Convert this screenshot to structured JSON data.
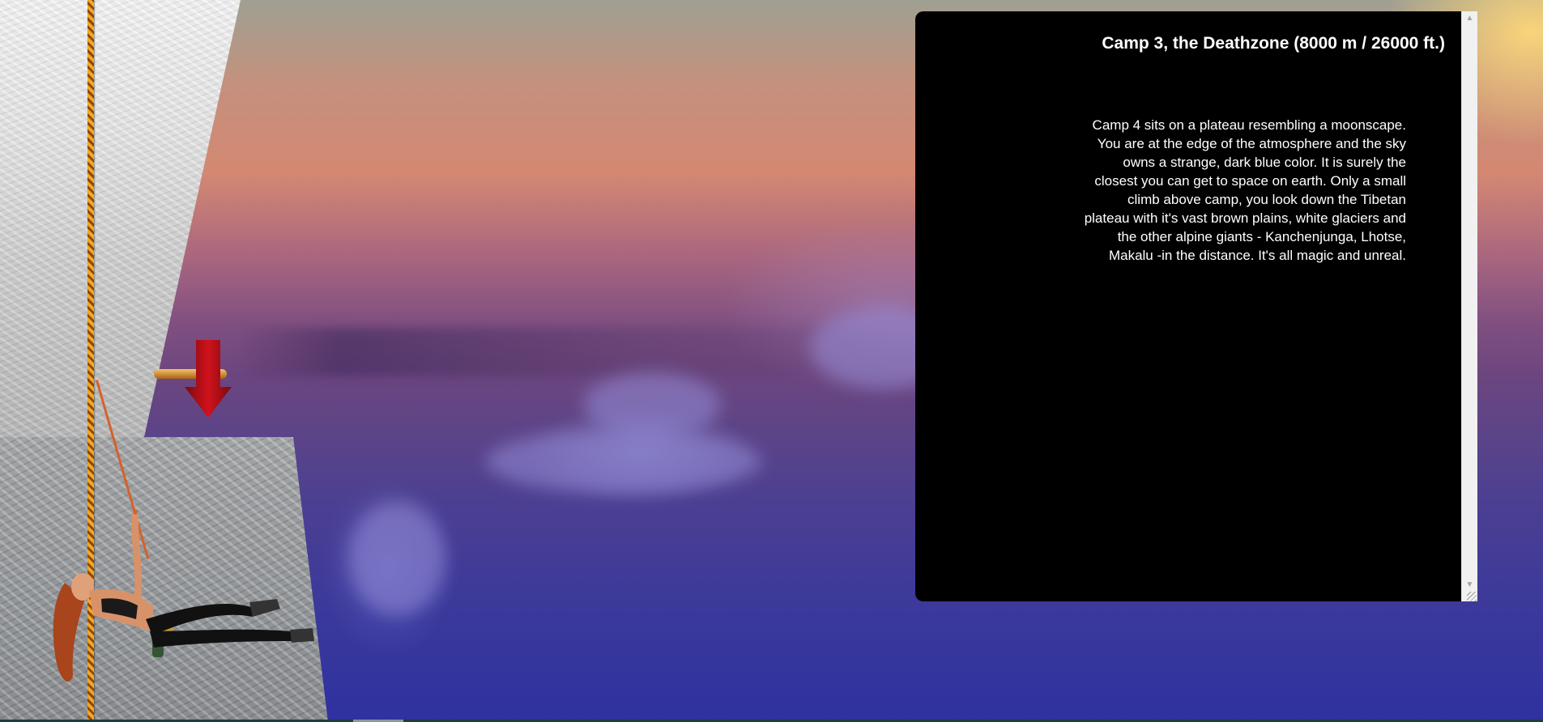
{
  "panel": {
    "title": "Camp 3, the Deathzone (8000 m / 26000 ft.)",
    "description": "Camp 4 sits on a plateau resembling a moonscape. You are at the edge of the atmosphere and the sky owns a strange, dark blue color. It is surely the closest you can get to space on earth. Only a small climb above camp, you look down the Tibetan plateau with it's vast brown plains, white glaciers and the other alpine giants - Kanchenjunga, Lhotse, Makalu -in the distance. It's all magic and unreal."
  },
  "scrollbar": {
    "up_glyph": "▲",
    "down_glyph": "▼"
  },
  "icons": {
    "nav_arrow": "down-arrow-icon",
    "climber": "climber-illustration",
    "rope": "rope"
  },
  "colors": {
    "panel_background": "#000000",
    "panel_text": "#ffffff",
    "arrow_red": "#b5101a",
    "rope_orange": "#f5a623",
    "sky_top": "#c5907d",
    "sky_bottom": "#2f31a0"
  }
}
